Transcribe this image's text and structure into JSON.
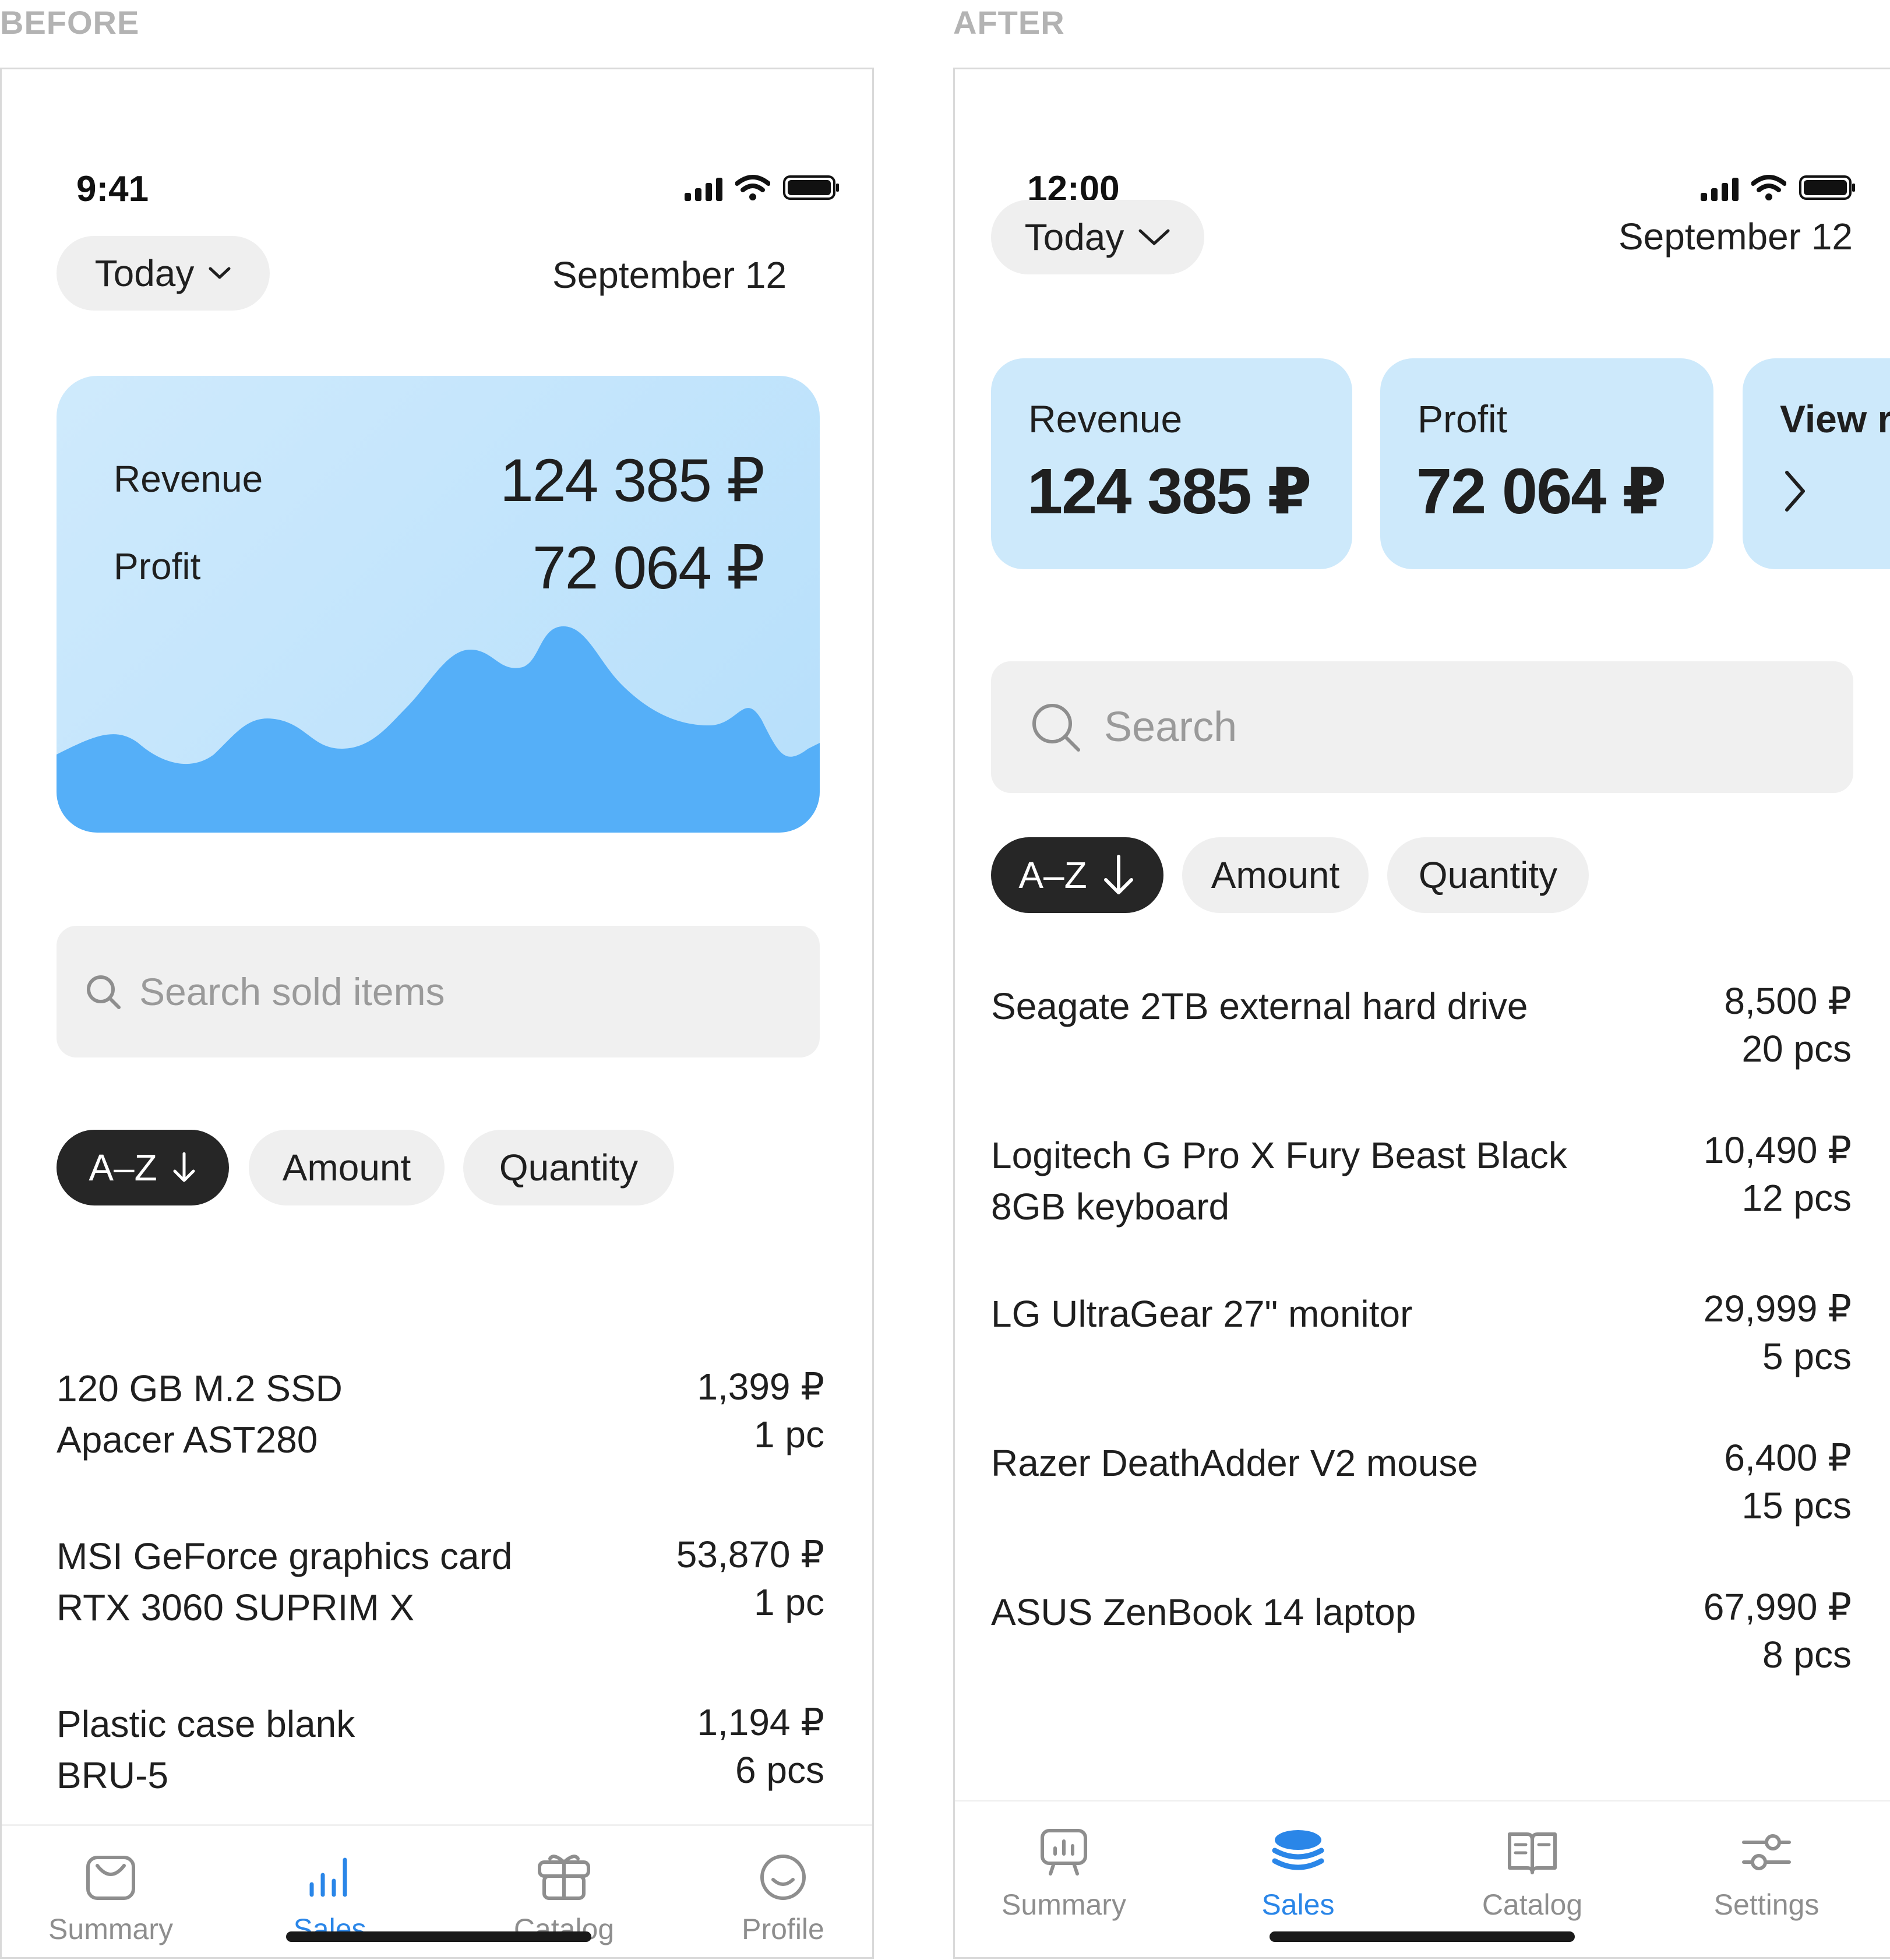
{
  "before": {
    "caption": "BEFORE",
    "status_time": "9:41",
    "period": "Today",
    "date": "September 12",
    "card": {
      "revenue_label": "Revenue",
      "revenue_value": "124 385 ₽",
      "profit_label": "Profit",
      "profit_value": "72 064 ₽"
    },
    "search_placeholder": "Search sold items",
    "sort": {
      "az": "A–Z",
      "amount": "Amount",
      "quantity": "Quantity"
    },
    "items": [
      {
        "line1": "120 GB M.2 SSD",
        "line2": "Apacer AST280",
        "price": "1,399 ₽",
        "qty": "1 pc"
      },
      {
        "line1": "MSI GeForce graphics card",
        "line2": "RTX 3060 SUPRIM X",
        "price": "53,870 ₽",
        "qty": "1 pc"
      },
      {
        "line1": "Plastic case blank",
        "line2": "BRU-5",
        "price": "1,194 ₽",
        "qty": "6 pcs"
      }
    ],
    "tabs": {
      "summary": "Summary",
      "sales": "Sales",
      "catalog": "Catalog",
      "profile": "Profile"
    }
  },
  "after": {
    "caption": "AFTER",
    "status_time": "12:00",
    "period": "Today",
    "date": "September 12",
    "cards": {
      "revenue_label": "Revenue",
      "revenue_value": "124 385 ₽",
      "profit_label": "Profit",
      "profit_value": "72 064 ₽",
      "more_label": "View r"
    },
    "search_placeholder": "Search",
    "sort": {
      "az": "A–Z",
      "amount": "Amount",
      "quantity": "Quantity"
    },
    "items": [
      {
        "line1": "Seagate 2TB external hard drive",
        "line2": "",
        "price": "8,500 ₽",
        "qty": "20 pcs"
      },
      {
        "line1": "Logitech G Pro X Fury Beast Black",
        "line2": "8GB keyboard",
        "price": "10,490 ₽",
        "qty": "12 pcs"
      },
      {
        "line1": "LG UltraGear 27\" monitor",
        "line2": "",
        "price": "29,999 ₽",
        "qty": "5 pcs"
      },
      {
        "line1": "Razer DeathAdder V2 mouse",
        "line2": "",
        "price": "6,400 ₽",
        "qty": "15 pcs"
      },
      {
        "line1": "ASUS ZenBook 14 laptop",
        "line2": "",
        "price": "67,990 ₽",
        "qty": "8 pcs"
      }
    ],
    "tabs": {
      "summary": "Summary",
      "sales": "Sales",
      "catalog": "Catalog",
      "settings": "Settings"
    }
  },
  "colors": {
    "accent": "#2a86e8",
    "card_bg": "#cde9fb",
    "chart_fill": "#55aff8",
    "chip_dark": "#262626",
    "chip_light": "#efefef"
  }
}
